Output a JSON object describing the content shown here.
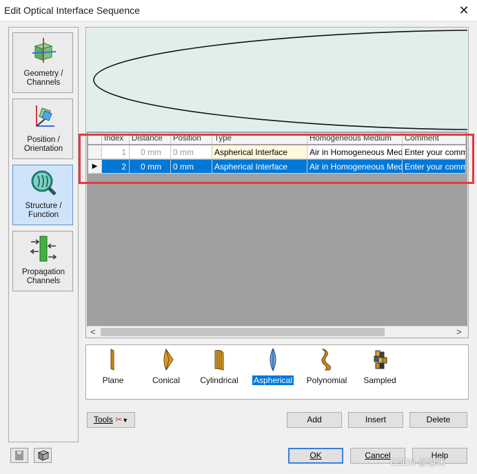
{
  "window": {
    "title": "Edit Optical Interface Sequence",
    "close_glyph": "✕"
  },
  "sidebar": {
    "items": [
      {
        "label_line1": "Geometry /",
        "label_line2": "Channels",
        "icon": "geometry-cube-icon",
        "selected": false
      },
      {
        "label_line1": "Position /",
        "label_line2": "Orientation",
        "icon": "position-axes-icon",
        "selected": false
      },
      {
        "label_line1": "Structure /",
        "label_line2": "Function",
        "icon": "magnifier-structure-icon",
        "selected": true
      },
      {
        "label_line1": "Propagation",
        "label_line2": "Channels",
        "icon": "propagation-arrows-icon",
        "selected": false
      }
    ]
  },
  "table": {
    "columns": [
      "Index",
      "Distance",
      "Position",
      "Type",
      "Homogeneous Medium",
      "Comment"
    ],
    "rows": [
      {
        "index": "1",
        "distance": "0 mm",
        "position": "0 mm",
        "type": "Aspherical Interface",
        "medium": "Air in Homogeneous Medium",
        "comment": "Enter your comment here"
      },
      {
        "index": "2",
        "distance": "0 mm",
        "position": "0 mm",
        "type": "Aspherical Interface",
        "medium": "Air in Homogeneous Medium",
        "comment": "Enter your comment here"
      }
    ],
    "current_row_marker": "▶",
    "scroll_left": "<",
    "scroll_right": ">"
  },
  "library": {
    "items": [
      {
        "label": "Plane",
        "icon": "plane-surface-icon"
      },
      {
        "label": "Conical",
        "icon": "conical-surface-icon"
      },
      {
        "label": "Cylindrical",
        "icon": "cylindrical-surface-icon"
      },
      {
        "label": "Aspherical",
        "icon": "aspherical-surface-icon",
        "selected": true
      },
      {
        "label": "Polynomial",
        "icon": "polynomial-surface-icon"
      },
      {
        "label": "Sampled",
        "icon": "sampled-surface-icon"
      }
    ]
  },
  "actions": {
    "tools": "Tools",
    "add": "Add",
    "insert": "Insert",
    "delete": "Delete"
  },
  "footer": {
    "ok": "OK",
    "cancel": "Cancel",
    "help": "Help",
    "watermark": "CSDN @澄渊"
  },
  "colors": {
    "selection": "#0078d7",
    "highlight_box": "#e8373e",
    "preview_bg": "#e1efec"
  }
}
